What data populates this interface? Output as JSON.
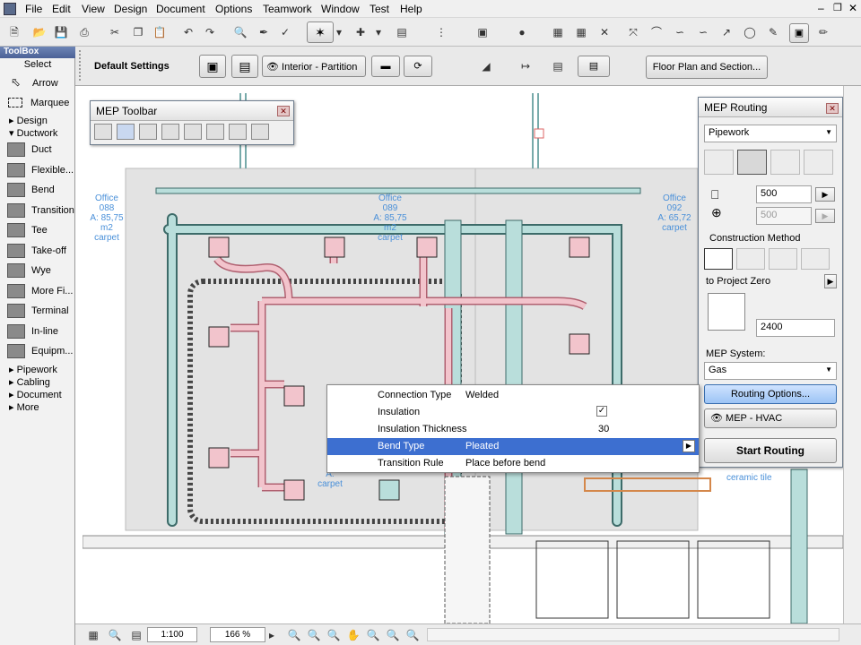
{
  "menus": [
    "File",
    "Edit",
    "View",
    "Design",
    "Document",
    "Options",
    "Teamwork",
    "Window",
    "Test",
    "Help"
  ],
  "toolbar2": {
    "default_settings": "Default Settings",
    "layer_combo": "Interior - Partition",
    "floor_plan_button": "Floor Plan and Section..."
  },
  "toolbox": {
    "title": "ToolBox",
    "select": "Select",
    "arrow": "Arrow",
    "marquee": "Marquee",
    "design": "Design",
    "ductwork": "Ductwork",
    "tools": [
      "Duct",
      "Flexible...",
      "Bend",
      "Transition",
      "Tee",
      "Take-off",
      "Wye",
      "More Fi...",
      "Terminal",
      "In-line",
      "Equipm..."
    ],
    "groups": [
      "Pipework",
      "Cabling",
      "Document",
      "More"
    ]
  },
  "mep_toolbar": {
    "title": "MEP Toolbar"
  },
  "mep_routing": {
    "title": "MEP Routing",
    "system_type": "Pipework",
    "width": "500",
    "height": "500",
    "construction_method_label": "Construction Method",
    "project_zero": "to Project Zero",
    "elevation": "2400",
    "mep_system_label": "MEP System:",
    "mep_system_value": "Gas",
    "routing_options": "Routing Options...",
    "hvac_label": "MEP - HVAC",
    "start_routing": "Start Routing"
  },
  "routing_popup": {
    "rows": [
      {
        "name": "Connection Type",
        "value": "Welded"
      },
      {
        "name": "Insulation",
        "value": "✓"
      },
      {
        "name": "Insulation Thickness",
        "value": "30"
      },
      {
        "name": "Bend Type",
        "value": "Pleated"
      },
      {
        "name": "Transition Rule",
        "value": "Place before bend"
      }
    ]
  },
  "plan_labels": {
    "office_left": "Office",
    "office_left_num": "088",
    "office_left_area": "A: 85,75 m2",
    "office_left_floor": "carpet",
    "office_mid": "Office",
    "office_mid_num": "089",
    "office_mid_area": "A: 85,75 m2",
    "office_mid_floor": "carpet",
    "office_right": "Office",
    "office_right_num": "092",
    "office_right_area": "A: 65,72",
    "office_right_floor": "carpet",
    "lower_area": "A:",
    "lower_floor": "carpet",
    "ceramic": "ceramic tile"
  },
  "statusbar": {
    "scale": "1:100",
    "zoom": "166 %"
  },
  "colors": {
    "duct_fill": "#b9dedb",
    "duct_outline": "#3d6b69",
    "pipe_pink": "#f2c4cc",
    "pipe_outline": "#b06070",
    "room_fill": "#e3e3e3",
    "selection": "#3d6fd0"
  }
}
